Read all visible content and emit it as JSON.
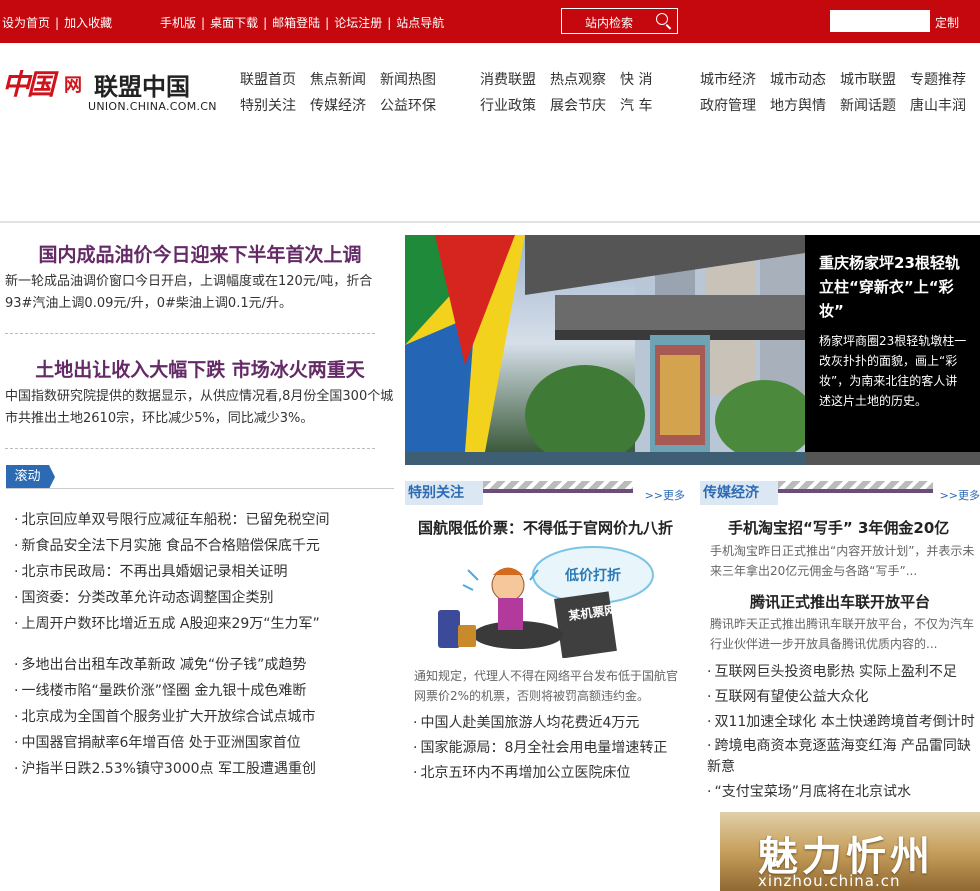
{
  "topbar": {
    "set_home": "设为首页",
    "add_favorite": "加入收藏",
    "mobile": "手机版",
    "desktop_download": "桌面下载",
    "mail_login": "邮箱登陆",
    "forum_register": "论坛注册",
    "site_nav": "站点导航",
    "search_label": "站内检索",
    "custom_button": "定制"
  },
  "logo": {
    "brand": "中国",
    "brand_suffix": "网",
    "name": "联盟中国",
    "url": "UNION.CHINA.COM.CN"
  },
  "nav": {
    "group1": [
      "联盟首页",
      "焦点新闻",
      "新闻热图",
      "特别关注",
      "传媒经济",
      "公益环保"
    ],
    "group2": [
      "消费联盟",
      "热点观察",
      "快 消",
      "行业政策",
      "展会节庆",
      "汽 车"
    ],
    "group3": [
      "城市经济",
      "城市动态",
      "城市联盟",
      "专题推荐",
      "政府管理",
      "地方舆情",
      "新闻话题",
      "唐山丰润"
    ]
  },
  "lead": {
    "story1_title": "国内成品油价今日迎来下半年首次上调",
    "story1_text": "新一轮成品油调价窗口今日开启，上调幅度或在120元/吨，折合93#汽油上调0.09元/升，0#柴油上调0.1元/升。",
    "story2_title": "土地出让收入大幅下跌  市场冰火两重天",
    "story2_text": "中国指数研究院提供的数据显示，从供应情况看,8月份全国300个城市共推出土地2610宗，环比减少5%，同比减少3%。"
  },
  "roll": {
    "tab_label": "滚动",
    "items": [
      "北京回应单双号限行应减征车船税：已留免税空间",
      "新食品安全法下月实施  食品不合格赔偿保底千元",
      "北京市民政局：不再出具婚姻记录相关证明",
      "国资委：分类改革允许动态调整国企类别",
      "上周开户数环比增近五成  A股迎来29万“生力军”",
      "多地出台出租车改革新政  减免“份子钱”成趋势",
      "一线楼市陷“量跌价涨”怪圈  金九银十成色难断",
      "北京成为全国首个服务业扩大开放综合试点城市",
      "中国器官捐献率6年增百倍  处于亚洲国家首位",
      "沪指半日跌2.53%镇守3000点  军工股遭遇重创"
    ]
  },
  "photo": {
    "title": "重庆杨家坪23根轻轨立柱“穿新衣”上“彩妆”",
    "text": "杨家坪商圈23根轻轨墩柱一改灰扑扑的面貌，画上“彩妆”，为南来北往的客人讲述这片土地的历史。"
  },
  "special": {
    "header": "特别关注",
    "more": ">>更多",
    "headline": "国航限低价票：不得低于官网价九八折",
    "cartoon_cloud": "低价打折",
    "cartoon_sign": "某机票网",
    "text": "通知规定，代理人不得在网络平台发布低于国航官网票价2%的机票，否则将被罚高额违约金。",
    "items": [
      "中国人赴美国旅游人均花费近4万元",
      "国家能源局：8月全社会用电量增速转正",
      "北京五环内不再增加公立医院床位"
    ]
  },
  "media": {
    "header": "传媒经济",
    "more": ">>更多",
    "headline1": "手机淘宝招“写手”  3年佣金20亿",
    "text1": "手机淘宝昨日正式推出“内容开放计划”，并表示未来三年拿出20亿元佣金与各路“写手”...",
    "headline2": "腾讯正式推出车联开放平台",
    "text2": "腾讯昨天正式推出腾讯车联开放平台，不仅为汽车行业伙伴进一步开放具备腾讯优质内容的...",
    "items": [
      "互联网巨头投资电影热  实际上盈利不足",
      "互联网有望使公益大众化",
      "双11加速全球化  本土快递跨境首考倒计时",
      "跨境电商资本竞逐蓝海变红海  产品雷同缺新意",
      "“支付宝菜场”月底将在北京试水"
    ]
  },
  "banner": {
    "title": "魅力忻州",
    "url": "xinzhou.china.cn"
  },
  "colors": {
    "topbar": "#c5070e",
    "headline_purple": "#642a66",
    "tab_blue": "#2c6bb4"
  }
}
